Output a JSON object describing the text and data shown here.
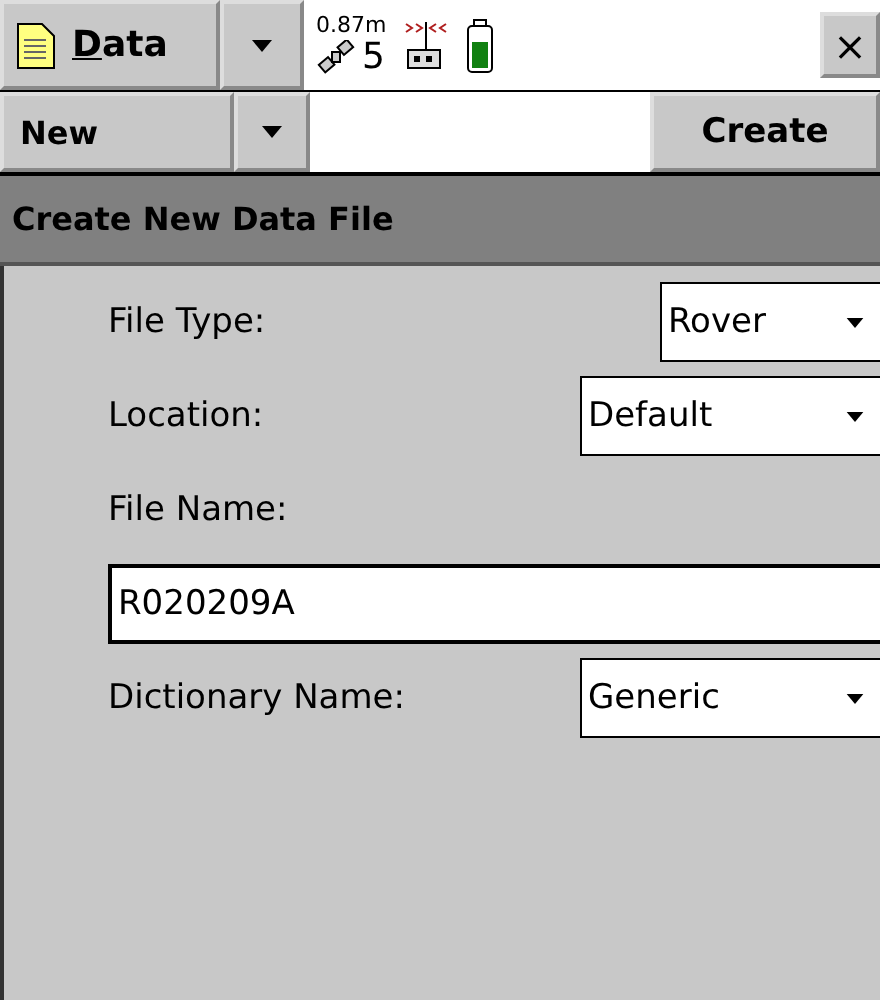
{
  "toolbar": {
    "menu_button": {
      "label": "Data"
    },
    "precision": "0.87m",
    "satellites": "5",
    "close": "×"
  },
  "command_bar": {
    "dropdown": {
      "label": "New"
    },
    "action_button": {
      "label": "Create"
    }
  },
  "form": {
    "title": "Create New Data File",
    "fields": [
      {
        "kind": "select",
        "label": "File Type:",
        "value": "Rover"
      },
      {
        "kind": "select",
        "label": "Location:",
        "value": "Default"
      },
      {
        "kind": "text",
        "label": "File Name:",
        "value": "R020209A"
      },
      {
        "kind": "select",
        "label": "Dictionary Name:",
        "value": "Generic"
      }
    ]
  }
}
